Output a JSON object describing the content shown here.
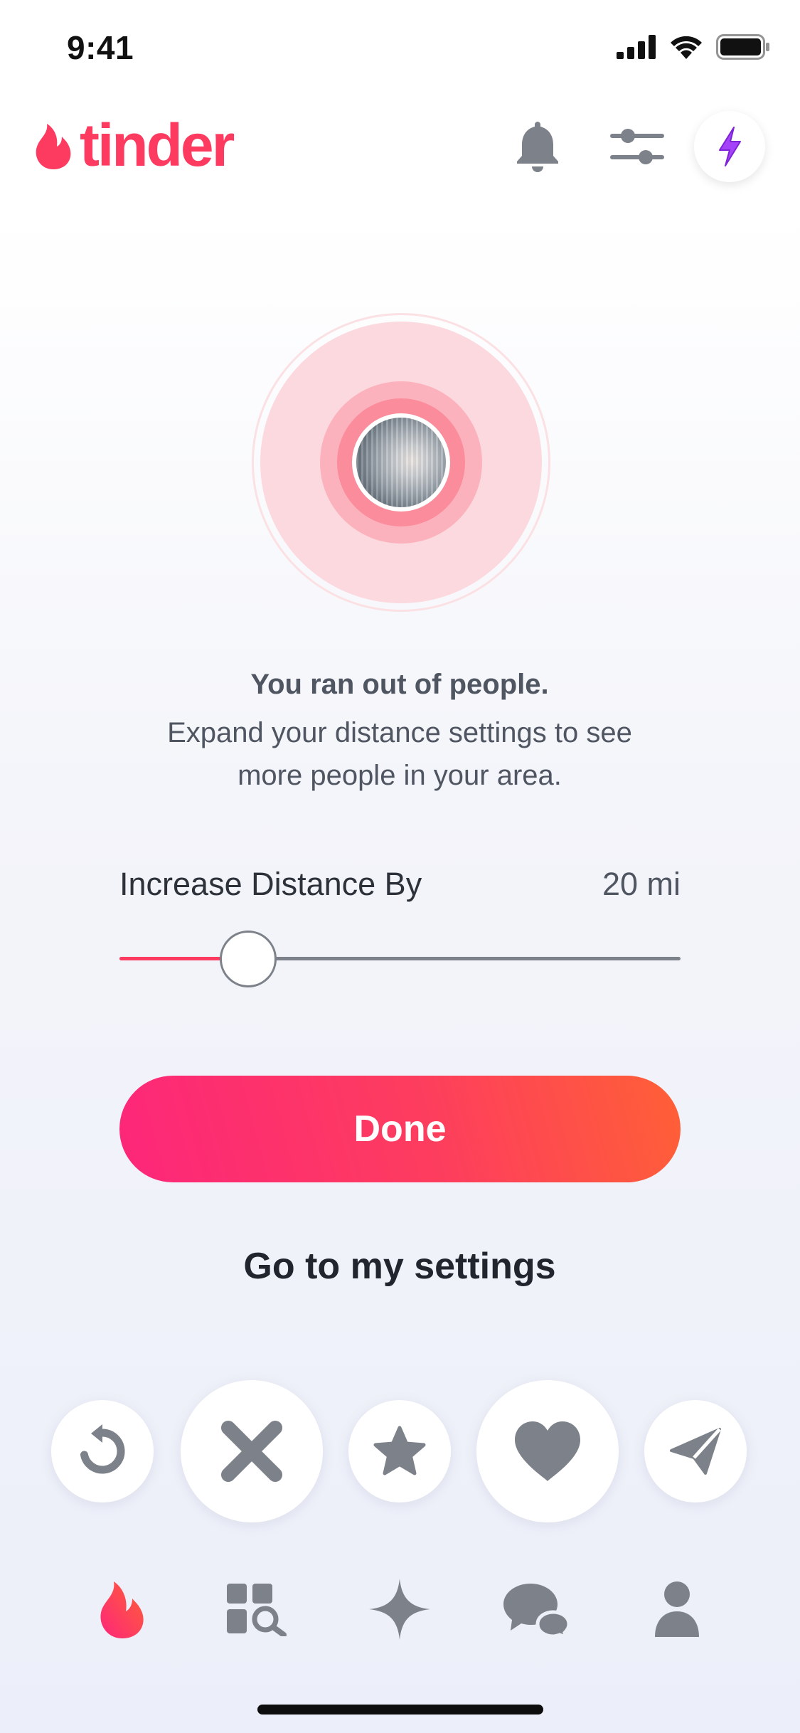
{
  "status_bar": {
    "time": "9:41"
  },
  "header": {
    "logo_text": "tinder"
  },
  "empty_state": {
    "title": "You ran out of people.",
    "body_line1": "Expand your distance settings to see",
    "body_line2": "more people in your area."
  },
  "distance": {
    "label": "Increase Distance By",
    "value_text": "20 mi",
    "slider_fraction": 0.23
  },
  "buttons": {
    "done_label": "Done",
    "settings_label": "Go to my settings"
  },
  "actions": [
    "rewind-icon",
    "nope-x-icon",
    "super-like-star-icon",
    "like-heart-icon",
    "send-paper-plane-icon"
  ],
  "tabs": [
    "flame-icon",
    "explore-icon",
    "sparkle-icon",
    "chat-icon",
    "profile-icon"
  ],
  "colors": {
    "brand": "#fd3a5f",
    "done_gradient_start": "#fd267a",
    "done_gradient_end": "#ff6036",
    "boost": "#a443f7",
    "icon_gray": "#7c818a"
  }
}
